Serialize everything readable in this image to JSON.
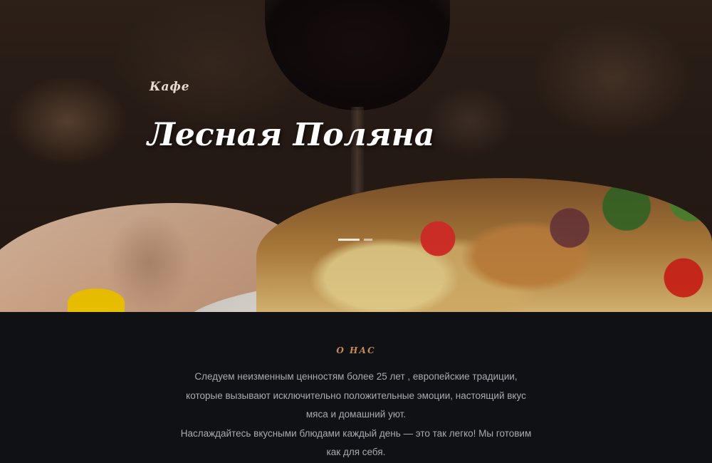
{
  "hero": {
    "subtitle": "Кафе",
    "title": "Лесная Поляна",
    "slider_dots": 2
  },
  "about": {
    "heading": "О НАС",
    "paragraph_1": "Следуем неизменным ценностям более 25 лет , европейские традиции, которые вызывают исключительно положительные эмоции, настоящий вкус мяса и домашний уют.",
    "paragraph_2": "Наслаждайтесь вкусными блюдами каждый день — это так легко! Мы готовим как для себя."
  },
  "colors": {
    "accent": "#c98a56",
    "background": "#0f1115",
    "body_text": "#a9abb0"
  }
}
